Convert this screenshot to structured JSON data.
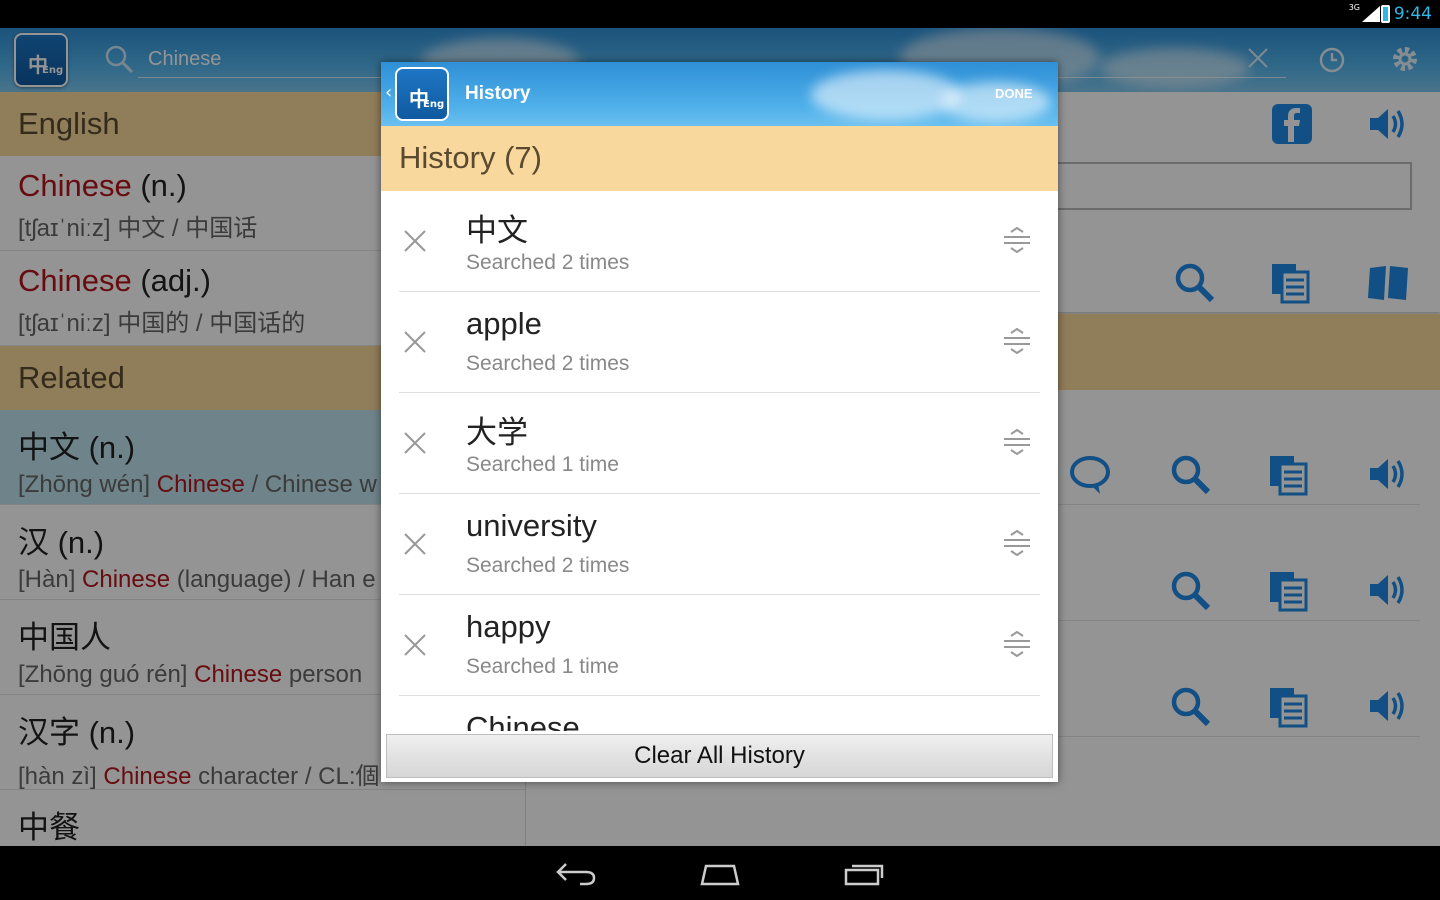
{
  "status": {
    "time": "9:44",
    "network": "3G"
  },
  "appbar": {
    "search_value": "Chinese",
    "logo_zh": "中",
    "logo_en": "Eng"
  },
  "left": {
    "english_header": "English",
    "english_entries": [
      {
        "word": "Chinese",
        "pos": " (n.)",
        "def": "[tʃaɪˈniːz] 中文 / 中国话"
      },
      {
        "word": "Chinese",
        "pos": " (adj.)",
        "def": "[tʃaɪˈniːz] 中国的 / 中国话的"
      }
    ],
    "related_header": "Related",
    "related_entries": [
      {
        "word": "中文 (n.)",
        "pre": "[Zhōng wén] ",
        "hit": "Chinese",
        "post": " / Chinese w"
      },
      {
        "word": "汉 (n.)",
        "pre": "[Hàn] ",
        "hit": "Chinese",
        "post": " (language) / Han e"
      },
      {
        "word": "中国人",
        "pre": "[Zhōng guó rén] ",
        "hit": "Chinese",
        "post": " person"
      },
      {
        "word": "汉字 (n.)",
        "pre": "[hàn zì] ",
        "hit": "Chinese",
        "post": " character / CL:個"
      },
      {
        "word": "中餐",
        "pre": "",
        "hit": "",
        "post": ""
      }
    ]
  },
  "dialog": {
    "title": "History",
    "done": "DONE",
    "header": "History (7)",
    "items": [
      {
        "term": "中文",
        "count": "Searched 2 times"
      },
      {
        "term": "apple",
        "count": "Searched 2 times"
      },
      {
        "term": "大学",
        "count": "Searched 1 time"
      },
      {
        "term": "university",
        "count": "Searched 2 times"
      },
      {
        "term": "happy",
        "count": "Searched 1 time"
      },
      {
        "term": "Chinese",
        "count": ""
      }
    ],
    "clear_all": "Clear All History"
  },
  "colors": {
    "accent": "#1e88e5",
    "header_band": "#f8d89c",
    "keyword": "#b1151c",
    "highlight": "#bfe3ee"
  }
}
